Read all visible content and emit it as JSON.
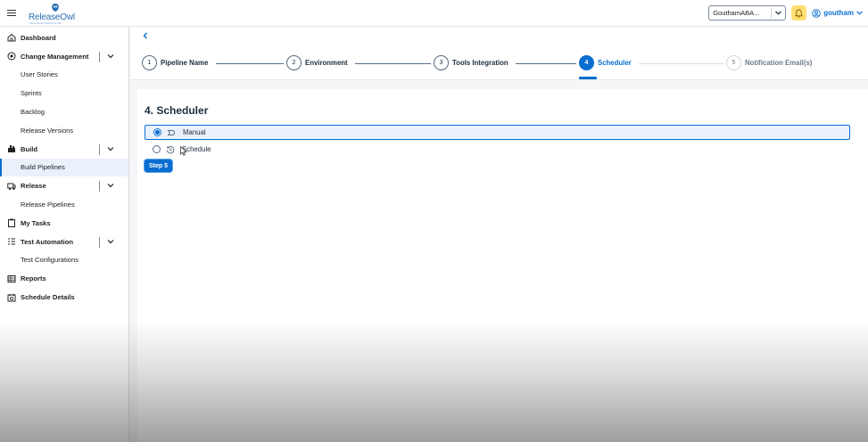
{
  "header": {
    "logo_name": "ReleaseOwl",
    "logo_tagline": "Native DevOps Platform for SAP",
    "tenant_value": "GouthamABA...",
    "user_name": "goutham"
  },
  "sidebar": {
    "items": [
      {
        "label": "Dashboard",
        "type": "top",
        "icon": "home-icon"
      },
      {
        "label": "Change Management",
        "type": "top",
        "icon": "change-icon",
        "expandable": true
      },
      {
        "label": "User Stories",
        "type": "sub"
      },
      {
        "label": "Sprints",
        "type": "sub"
      },
      {
        "label": "Backlog",
        "type": "sub"
      },
      {
        "label": "Release Versions",
        "type": "sub"
      },
      {
        "label": "Build",
        "type": "top",
        "icon": "build-icon",
        "expandable": true
      },
      {
        "label": "Build Pipelines",
        "type": "sub",
        "active": true
      },
      {
        "label": "Release",
        "type": "top",
        "icon": "release-icon",
        "expandable": true
      },
      {
        "label": "Release Pipelines",
        "type": "sub"
      },
      {
        "label": "My Tasks",
        "type": "top",
        "icon": "tasks-icon"
      },
      {
        "label": "Test Automation",
        "type": "top",
        "icon": "test-icon",
        "expandable": true
      },
      {
        "label": "Test Configurations",
        "type": "sub"
      },
      {
        "label": "Reports",
        "type": "top",
        "icon": "reports-icon"
      },
      {
        "label": "Schedule Details",
        "type": "top",
        "icon": "schedule-icon"
      }
    ]
  },
  "wizard": {
    "steps": [
      {
        "number": "1",
        "label": "Pipeline Name",
        "state": "done"
      },
      {
        "number": "2",
        "label": "Environment",
        "state": "done"
      },
      {
        "number": "3",
        "label": "Tools Integration",
        "state": "done"
      },
      {
        "number": "4",
        "label": "Scheduler",
        "state": "active"
      },
      {
        "number": "5",
        "label": "Notification Email(s)",
        "state": "future"
      }
    ]
  },
  "scheduler": {
    "title": "4. Scheduler",
    "options": [
      {
        "label": "Manual",
        "selected": true,
        "icon": "manual-icon"
      },
      {
        "label": "Schedule",
        "selected": false,
        "icon": "history-icon"
      }
    ],
    "next_button": "Step 5"
  },
  "colors": {
    "accent": "#0a6ed1",
    "bell_bg": "#ffdf72",
    "selected_bg": "#eaf1fb"
  }
}
